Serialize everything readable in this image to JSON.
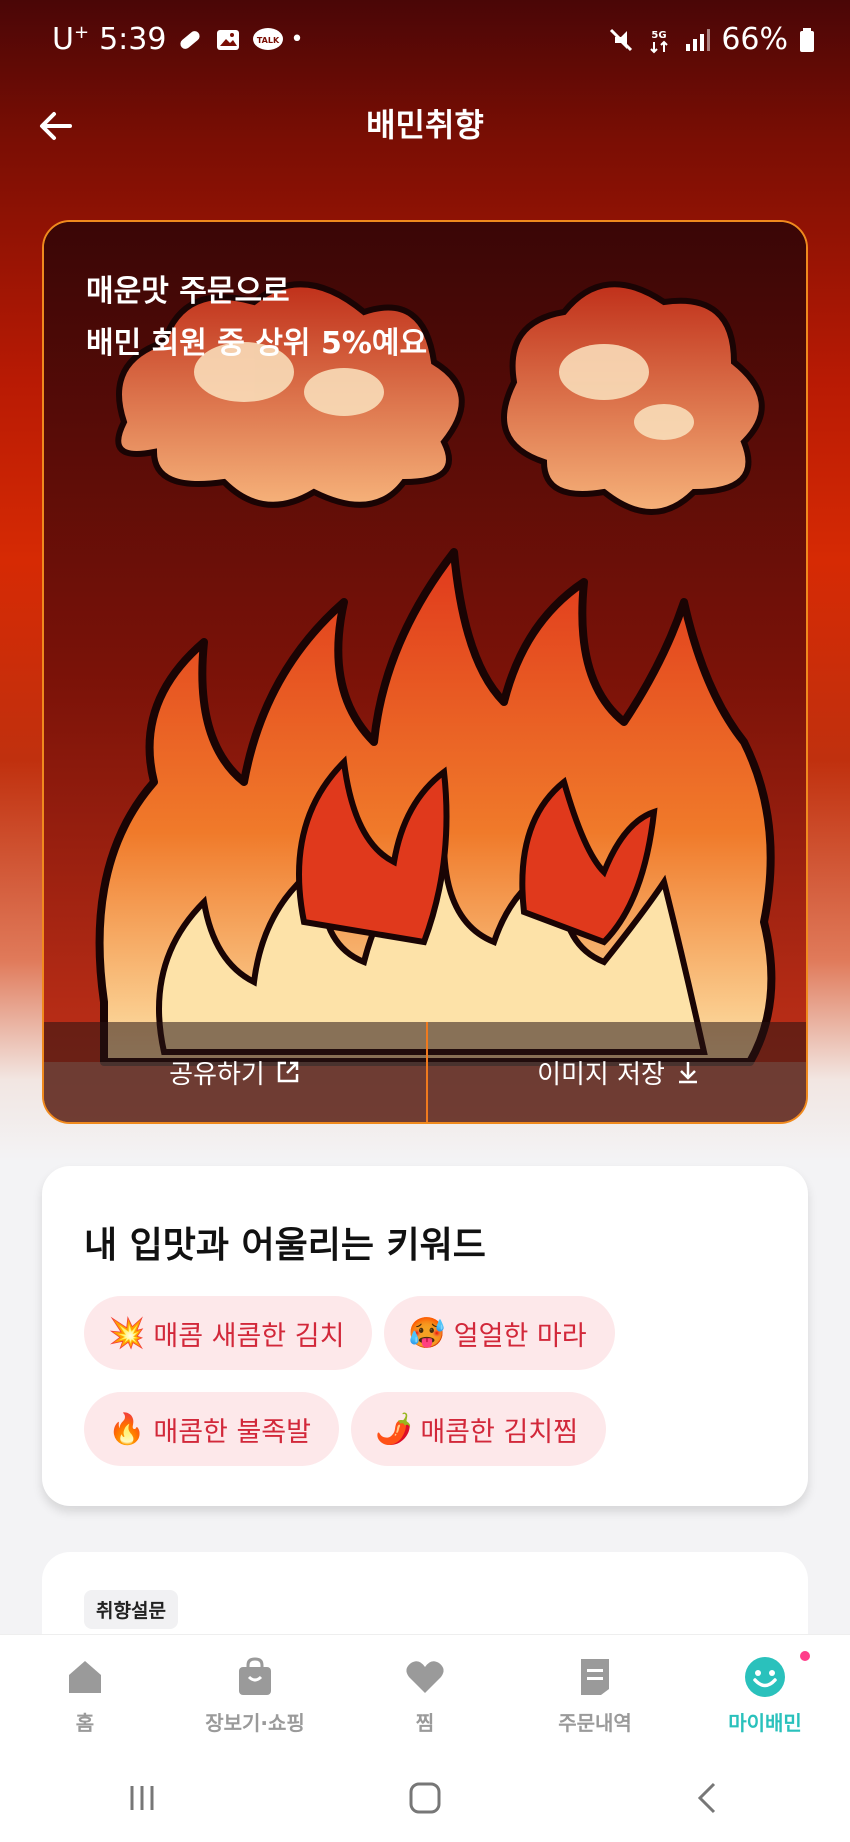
{
  "status_bar": {
    "carrier": "U",
    "carrier_sup": "+",
    "time": "5:39",
    "battery": "66%"
  },
  "header": {
    "title": "배민취향"
  },
  "hero": {
    "line1": "매운맛 주문으로",
    "line2": "배민 회원 중 상위 5%예요",
    "share_label": "공유하기",
    "save_label": "이미지 저장"
  },
  "keywords": {
    "title": "내 입맛과 어울리는 키워드",
    "chips": [
      {
        "emoji": "💥",
        "label": "매콤 새콤한 김치"
      },
      {
        "emoji": "🥵",
        "label": "얼얼한 마라"
      },
      {
        "emoji": "🔥",
        "label": "매콤한 불족발"
      },
      {
        "emoji": "🌶️",
        "label": "매콤한 김치찜"
      }
    ]
  },
  "survey": {
    "badge": "취향설문"
  },
  "bottom_nav": {
    "items": [
      {
        "label": "홈",
        "icon": "home-icon"
      },
      {
        "label": "장보기·쇼핑",
        "icon": "shopping-bag-icon"
      },
      {
        "label": "찜",
        "icon": "heart-icon"
      },
      {
        "label": "주문내역",
        "icon": "receipt-icon"
      },
      {
        "label": "마이배민",
        "icon": "smile-icon"
      }
    ],
    "active_color": "#2ac1bc"
  },
  "colors": {
    "accent": "#2ac1bc",
    "chip_bg": "#fde8ea",
    "chip_text": "#d2283a",
    "card_border": "#f08a1e"
  }
}
